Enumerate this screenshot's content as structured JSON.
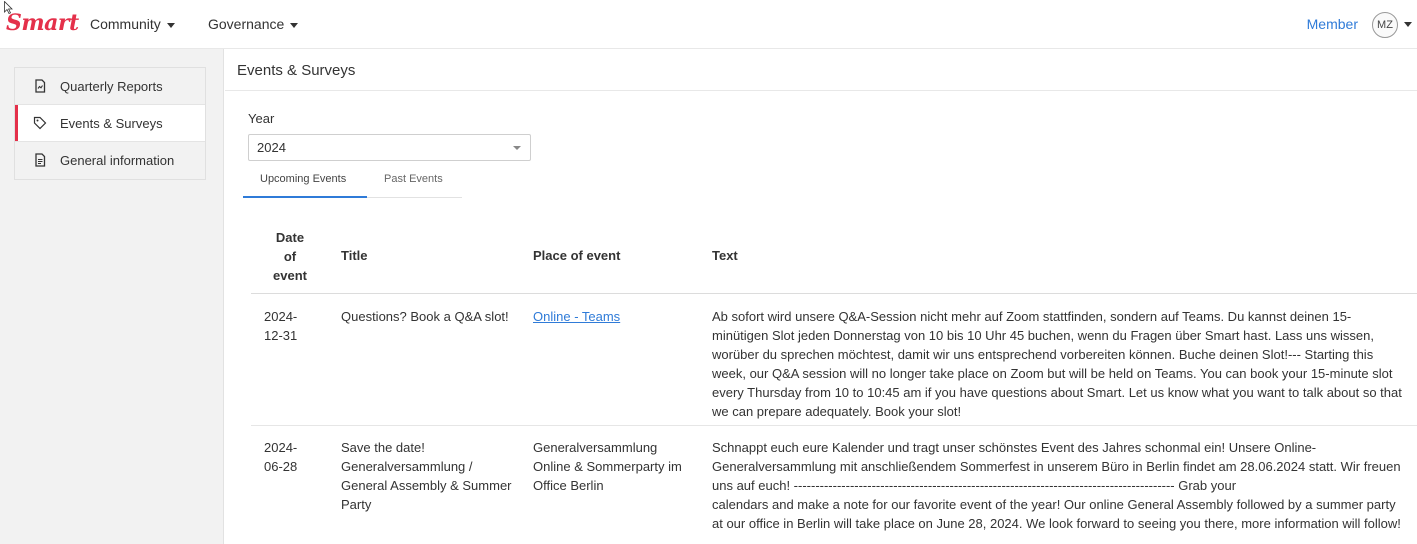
{
  "brand": {
    "logo_text": "Smart"
  },
  "nav": {
    "items": [
      {
        "label": "Community"
      },
      {
        "label": "Governance"
      }
    ],
    "member_label": "Member",
    "avatar_initials": "MZ"
  },
  "sidebar": {
    "items": [
      {
        "label": "Quarterly Reports",
        "icon": "report-icon",
        "active": false
      },
      {
        "label": "Events & Surveys",
        "icon": "tag-icon",
        "active": true
      },
      {
        "label": "General information",
        "icon": "document-icon",
        "active": false
      }
    ]
  },
  "page": {
    "title": "Events & Surveys"
  },
  "filter": {
    "year_label": "Year",
    "year_value": "2024"
  },
  "tabs": [
    {
      "label": "Upcoming Events",
      "active": true
    },
    {
      "label": "Past Events",
      "active": false
    }
  ],
  "table": {
    "headers": {
      "date_line1": "Date",
      "date_line2": "of",
      "date_line3": "event",
      "title": "Title",
      "place": "Place of event",
      "text": "Text"
    },
    "rows": [
      {
        "date_line1": "2024-",
        "date_line2": "12-31",
        "title_lines": [
          "Questions? Book a Q&A slot!"
        ],
        "place_link": "Online - Teams",
        "text_lines": [
          "Ab sofort wird unsere Q&A-Session nicht mehr auf Zoom stattfinden, sondern auf Teams. Du kannst deinen 15-",
          "minütigen Slot jeden Donnerstag von 10 bis 10 Uhr 45 buchen, wenn du Fragen über Smart hast. Lass uns wissen,",
          "worüber du sprechen möchtest, damit wir uns entsprechend vorbereiten können. Buche deinen Slot!--- Starting this",
          "week, our Q&A session will no longer take place on Zoom but will be held on Teams. You can book your 15-minute slot",
          "every Thursday from 10 to 10:45 am if you have questions about Smart. Let us know what you want to talk about so that",
          "we can prepare adequately. Book your slot!"
        ]
      },
      {
        "date_line1": "2024-",
        "date_line2": "06-28",
        "title_lines": [
          "Save the date!",
          "Generalversammlung /",
          "General Assembly & Summer",
          "Party"
        ],
        "place_lines": [
          "Generalversammlung",
          "Online & Sommerparty im",
          "Office Berlin"
        ],
        "text_lines": [
          "Schnappt euch eure Kalender und tragt unser schönstes Event des Jahres schonmal ein! Unsere Online-",
          "Generalversammlung mit anschließendem Sommerfest in unserem Büro in Berlin findet am 28.06.2024 statt. Wir freuen",
          "uns auf euch! ---------------------------------------------------------------------------------------- Grab your",
          "calendars and make a note for our favorite event of the year! Our online General Assembly followed by a summer party",
          "at our office in Berlin will take place on June 28, 2024. We look forward to seeing you there, more information will follow!"
        ]
      }
    ]
  },
  "colors": {
    "brand": "#e4304a",
    "link": "#2f7bd8",
    "sidebar_bg": "#f2f2f2"
  }
}
